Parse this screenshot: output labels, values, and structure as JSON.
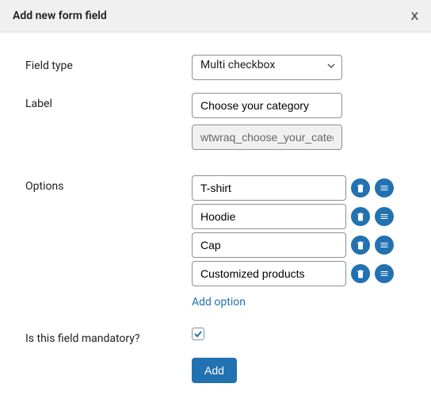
{
  "dialog": {
    "title": "Add new form field",
    "close_label": "X"
  },
  "fields": {
    "field_type": {
      "label": "Field type",
      "value": "Multi checkbox"
    },
    "label": {
      "label": "Label",
      "value": "Choose your category"
    },
    "slug": {
      "value": "wtwraq_choose_your_category"
    },
    "options": {
      "label": "Options",
      "items": [
        "T-shirt",
        "Hoodie",
        "Cap",
        "Customized products"
      ],
      "add_link": "Add option"
    },
    "mandatory": {
      "label": "Is this field mandatory?",
      "checked": true
    },
    "submit": {
      "label": "Add"
    }
  }
}
